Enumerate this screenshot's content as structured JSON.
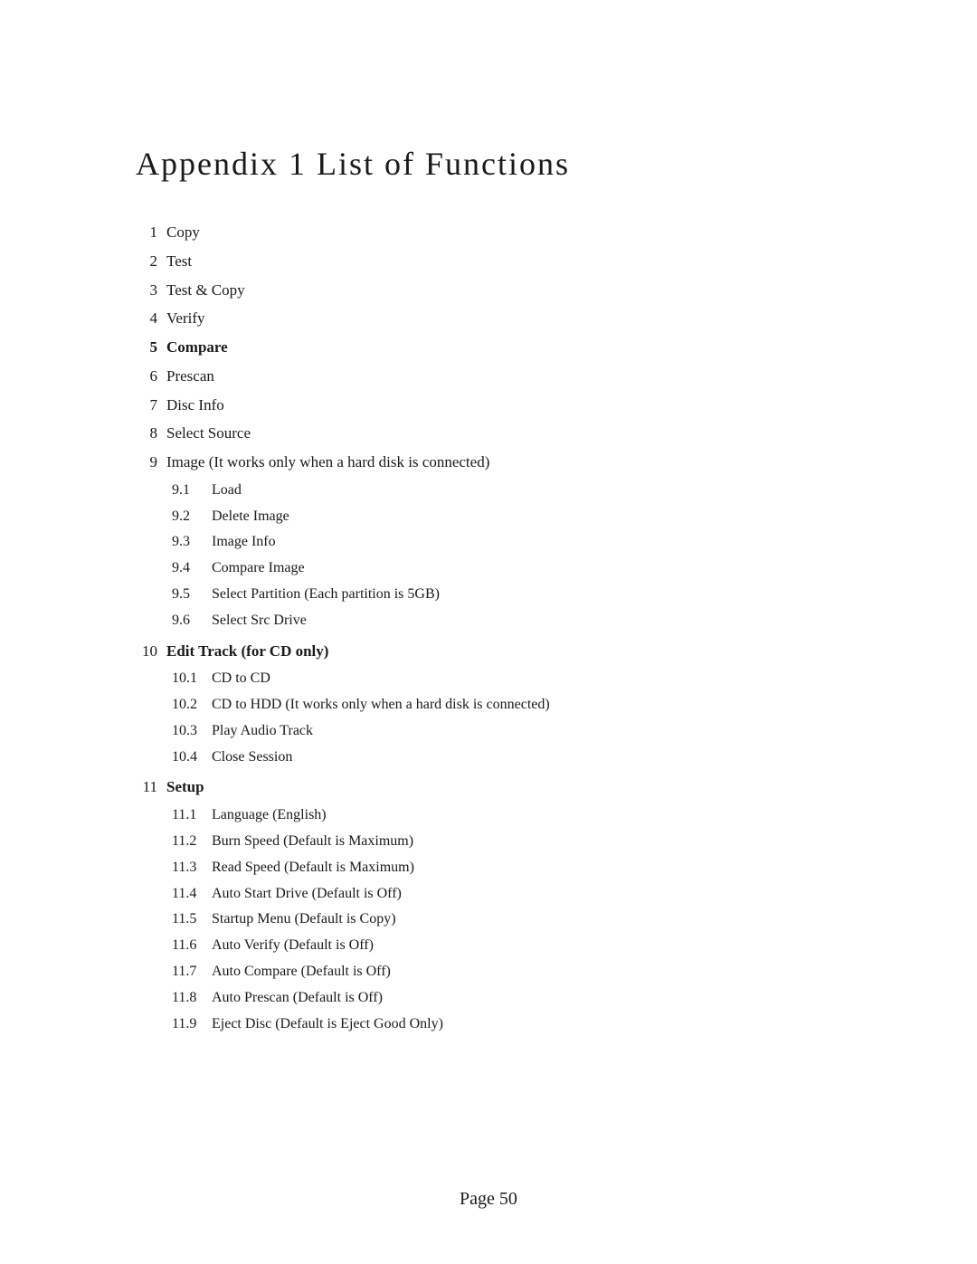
{
  "title": "Appendix 1    List of Functions",
  "items": [
    {
      "num": "1",
      "label": "Copy",
      "bold": false
    },
    {
      "num": "2",
      "label": "Test",
      "bold": false
    },
    {
      "num": "3",
      "label": "Test & Copy",
      "bold": false
    },
    {
      "num": "4",
      "label": "Verify",
      "bold": false
    },
    {
      "num": "5",
      "label": "Compare",
      "bold": true
    },
    {
      "num": "6",
      "label": "Prescan",
      "bold": false
    },
    {
      "num": "7",
      "label": "Disc Info",
      "bold": false
    },
    {
      "num": "8",
      "label": "Select Source",
      "bold": false
    },
    {
      "num": "9",
      "label": "Image  (It works only when a hard disk is connected)",
      "bold": false
    },
    {
      "num": "10",
      "label": "Edit Track (for CD only)",
      "bold": true
    },
    {
      "num": "11",
      "label": "Setup",
      "bold": true
    }
  ],
  "sub_items_9": [
    {
      "num": "9.1",
      "label": "Load"
    },
    {
      "num": "9.2",
      "label": "Delete Image"
    },
    {
      "num": "9.3",
      "label": "Image Info"
    },
    {
      "num": "9.4",
      "label": "Compare Image"
    },
    {
      "num": "9.5",
      "label": "Select Partition  (Each partition is 5GB)"
    },
    {
      "num": "9.6",
      "label": "Select Src Drive"
    }
  ],
  "sub_items_10": [
    {
      "num": "10.1",
      "label": "CD to CD"
    },
    {
      "num": "10.2",
      "label": "CD to HDD  (It works only when a hard disk is connected)"
    },
    {
      "num": "10.3",
      "label": "Play Audio Track"
    },
    {
      "num": "10.4",
      "label": "Close Session"
    }
  ],
  "sub_items_11": [
    {
      "num": "11.1",
      "label": "Language  (English)"
    },
    {
      "num": "11.2",
      "label": "Burn Speed  (Default is Maximum)"
    },
    {
      "num": "11.3",
      "label": "Read Speed   (Default is Maximum)"
    },
    {
      "num": "11.4",
      "label": "Auto Start Drive  (Default is Off)"
    },
    {
      "num": "11.5",
      "label": "Startup Menu  (Default is Copy)"
    },
    {
      "num": "11.6",
      "label": "Auto Verify  (Default is Off)"
    },
    {
      "num": "11.7",
      "label": "Auto Compare  (Default is Off)"
    },
    {
      "num": "11.8",
      "label": "Auto Prescan  (Default is Off)"
    },
    {
      "num": "11.9",
      "label": "Eject Disc  (Default is Eject Good Only)"
    }
  ],
  "footer": "Page 50"
}
